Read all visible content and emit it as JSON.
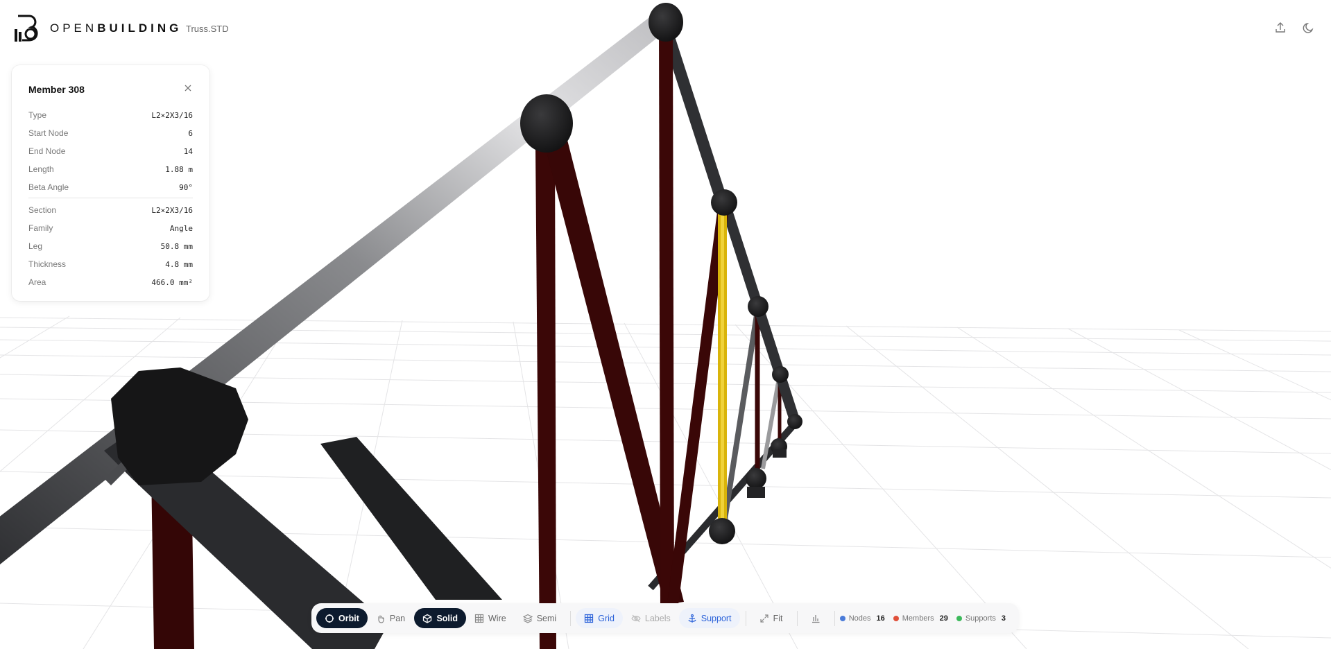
{
  "app": {
    "logo_open": "OPEN",
    "logo_building": "BUILDING",
    "file_name": "Truss.STD"
  },
  "header_icons": [
    "upload-icon",
    "moon-icon"
  ],
  "panel": {
    "title": "Member 308",
    "rows": [
      {
        "key": "Type",
        "value": "L2×2X3/16"
      },
      {
        "key": "Start Node",
        "value": "6"
      },
      {
        "key": "End Node",
        "value": "14"
      },
      {
        "key": "Length",
        "value": "1.88 m"
      },
      {
        "key": "Beta Angle",
        "value": "90°"
      }
    ],
    "section_rows": [
      {
        "key": "Section",
        "value": "L2×2X3/16"
      },
      {
        "key": "Family",
        "value": "Angle"
      },
      {
        "key": "Leg",
        "value": "50.8 mm"
      },
      {
        "key": "Thickness",
        "value": "4.8 mm"
      },
      {
        "key": "Area",
        "value": "466.0 mm²"
      }
    ]
  },
  "toolbar": {
    "orbit": "Orbit",
    "pan": "Pan",
    "solid": "Solid",
    "wire": "Wire",
    "semi": "Semi",
    "grid": "Grid",
    "labels": "Labels",
    "support": "Support",
    "fit": "Fit"
  },
  "stats": {
    "nodes_label": "Nodes",
    "nodes": "16",
    "members_label": "Members",
    "members": "29",
    "supports_label": "Supports",
    "supports": "3"
  },
  "colors": {
    "chord": "#2f3033",
    "web_member": "#3a0707",
    "selected": "#d9b40a",
    "node": "#1c1c1e",
    "accent": "#2b62d9",
    "active_bg": "#0d1b2e",
    "nodes_dot": "#4a7bd8",
    "members_dot": "#e0503a",
    "supports_dot": "#3cb95b"
  }
}
